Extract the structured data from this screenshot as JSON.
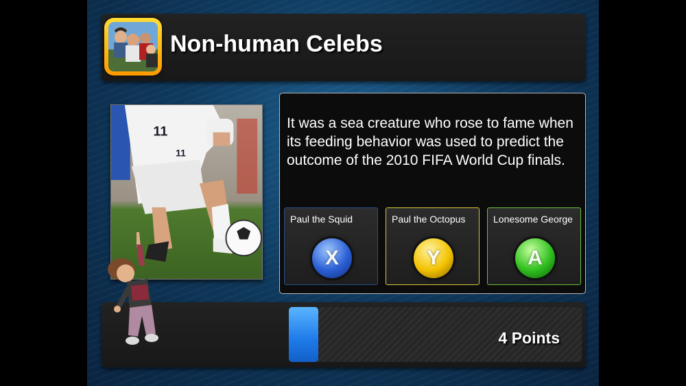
{
  "category": {
    "title": "Non-human Celebs",
    "icon": "group-photo-icon"
  },
  "photo": {
    "icon": "soccer-player-photo",
    "jersey_number": "11"
  },
  "question": {
    "text": "It was a sea creature who rose to fame when its feeding behavior was used to predict the outcome of the 2010 FIFA World Cup finals."
  },
  "answers": [
    {
      "label": "Paul the Squid",
      "button": "X",
      "color": "#2a5fd4"
    },
    {
      "label": "Paul the Octopus",
      "button": "Y",
      "color": "#f2c200"
    },
    {
      "label": "Lonesome George",
      "button": "A",
      "color": "#2fbf1e"
    }
  ],
  "timer": {
    "fraction": 0.1
  },
  "score": {
    "points": "4 Points"
  },
  "avatar": {
    "icon": "player-avatar"
  }
}
